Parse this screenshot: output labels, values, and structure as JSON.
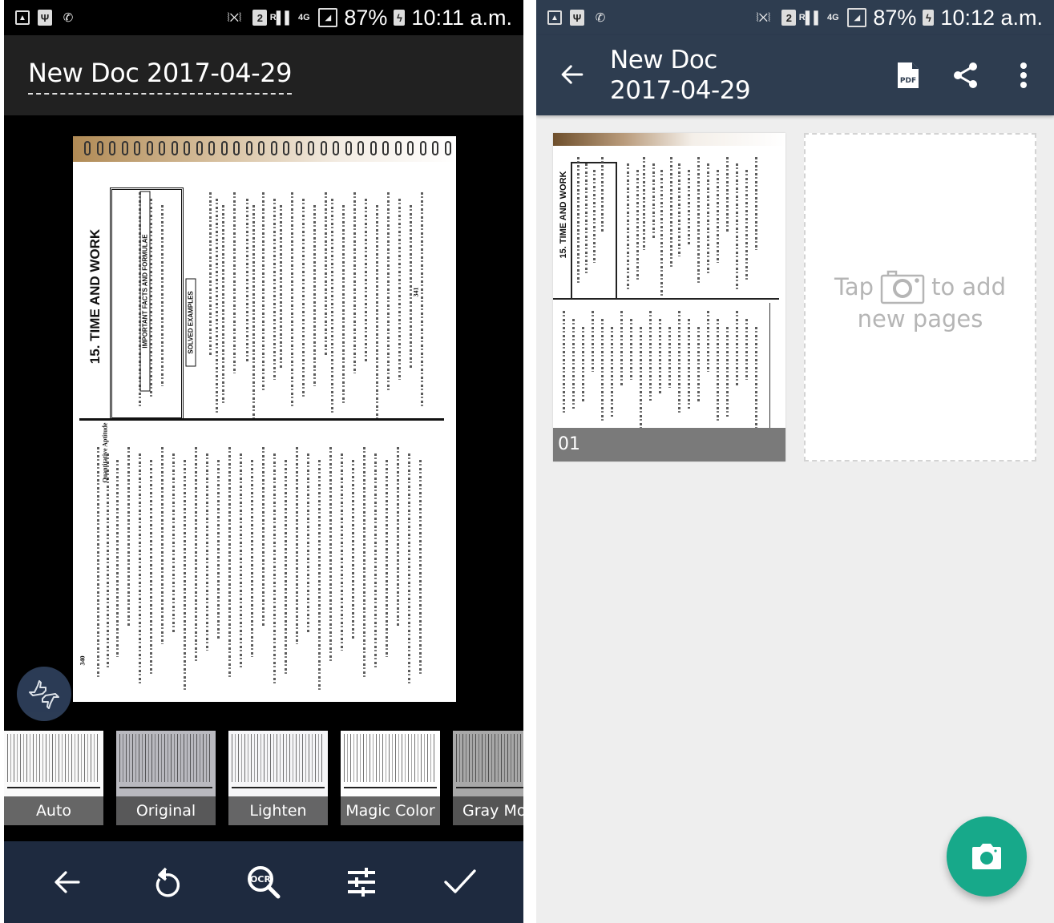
{
  "left_screen": {
    "status_bar": {
      "left_icons": [
        "gallery-icon",
        "usb-icon",
        "wifi-calling-icon"
      ],
      "right_icons": [
        "vibrate-icon",
        "sim-2-icon",
        "roaming-signal-icon",
        "4g-icon",
        "signal-icon"
      ],
      "sim_label": "2",
      "roaming_label": "R",
      "network_label": "4G",
      "battery": "87%",
      "time": "10:11 a.m."
    },
    "header": {
      "title": "New Doc 2017-04-29"
    },
    "preview": {
      "page_heading": "15. TIME AND WORK",
      "facts_heading": "IMPORTANT FACTS AND FORMULAE",
      "examples_heading": "SOLVED EXAMPLES",
      "page_number_top": "341",
      "page_number_bottom": "340",
      "section_label": "Quantitative Aptitude"
    },
    "rating_button": {
      "icon": "thumbs-up-down-icon"
    },
    "filters": [
      {
        "label": "Auto",
        "selected": false
      },
      {
        "label": "Original",
        "selected": false
      },
      {
        "label": "Lighten",
        "selected": false
      },
      {
        "label": "Magic Color",
        "selected": true
      },
      {
        "label": "Gray Mode",
        "selected": false
      }
    ],
    "toolbar": [
      {
        "name": "back",
        "icon": "arrow-left-icon"
      },
      {
        "name": "rotate",
        "icon": "rotate-left-icon"
      },
      {
        "name": "ocr",
        "icon": "ocr-search-icon",
        "label": "OCR"
      },
      {
        "name": "adjust",
        "icon": "sliders-icon"
      },
      {
        "name": "confirm",
        "icon": "check-icon"
      }
    ]
  },
  "right_screen": {
    "status_bar": {
      "sim_label": "2",
      "roaming_label": "R",
      "network_label": "4G",
      "battery": "87%",
      "time": "10:12 a.m."
    },
    "header": {
      "title_line1": "New Doc",
      "title_line2": "2017-04-29",
      "actions": [
        {
          "name": "pdf",
          "icon": "pdf-icon",
          "label": "PDF"
        },
        {
          "name": "share",
          "icon": "share-icon"
        },
        {
          "name": "more",
          "icon": "more-vert-icon"
        }
      ]
    },
    "pages": [
      {
        "label": "01",
        "heading": "15. TIME AND WORK"
      }
    ],
    "add_page": {
      "text_before": "Tap",
      "text_after": "to add",
      "text_line2": "new pages",
      "icon": "camera-icon"
    },
    "fab": {
      "icon": "camera-icon"
    }
  },
  "colors": {
    "accent": "#1fb58f",
    "fab": "#17a98a",
    "left_toolbar": "#1e2a3f",
    "right_header": "#2e3d50",
    "left_header": "#212121"
  }
}
